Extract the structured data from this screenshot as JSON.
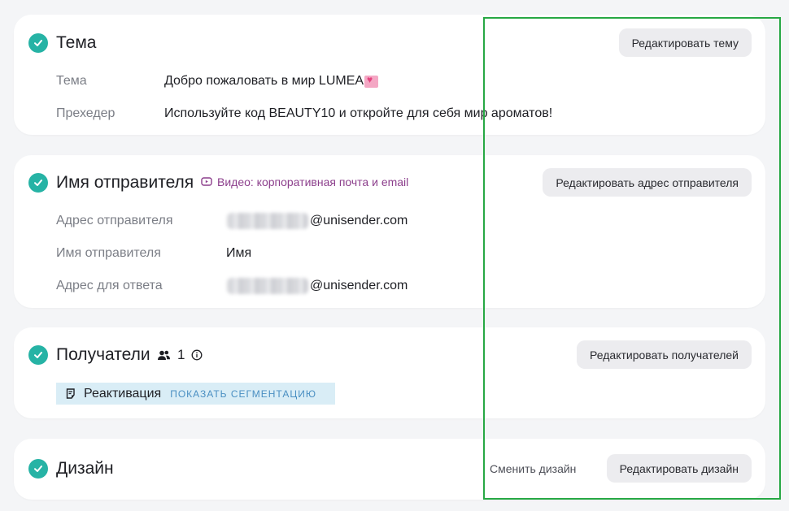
{
  "subject_section": {
    "title": "Тема",
    "edit_button": "Редактировать тему",
    "rows": [
      {
        "label": "Тема",
        "value": "Добро пожаловать в мир LUMEA"
      },
      {
        "label": "Прехедер",
        "value": "Используйте код BEAUTY10 и откройте для себя мир ароматов!"
      }
    ]
  },
  "sender_section": {
    "title": "Имя отправителя",
    "video_link": "Видео: корпоративная почта и email",
    "edit_button": "Редактировать адрес отправителя",
    "rows": [
      {
        "label": "Адрес отправителя",
        "value": "@unisender.com"
      },
      {
        "label": "Имя отправителя",
        "value": "Имя"
      },
      {
        "label": "Адрес для ответа",
        "value": "@unisender.com"
      }
    ]
  },
  "recipients_section": {
    "title": "Получатели",
    "count": "1",
    "edit_button": "Редактировать получателей",
    "segment_label": "Реактивация",
    "segment_link": "ПОКАЗАТЬ СЕГМЕНТАЦИЮ"
  },
  "design_section": {
    "title": "Дизайн",
    "change_link": "Сменить дизайн",
    "edit_button": "Редактировать дизайн"
  },
  "colors": {
    "accent": "#26b3a5",
    "video_link": "#8c3f8c",
    "segment_bg": "#d9edf6",
    "highlight": "#27a844"
  },
  "icons": [
    "check-circle-icon",
    "video-icon",
    "users-icon",
    "info-icon",
    "segment-doc-icon",
    "heart-emoji-icon"
  ]
}
